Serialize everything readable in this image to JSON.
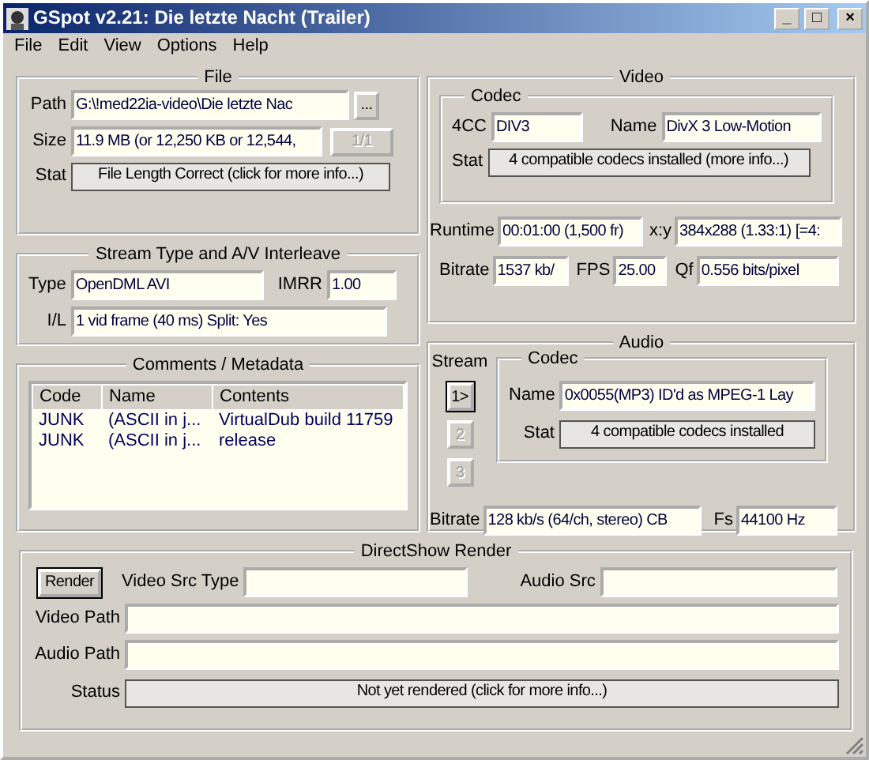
{
  "window": {
    "title": "GSpot v2.21: Die letzte Nacht (Trailer)",
    "controls": [
      "_",
      "□",
      "×"
    ]
  },
  "menu": [
    "File",
    "Edit",
    "View",
    "Options",
    "Help"
  ],
  "file": {
    "title": "File",
    "path": {
      "label": "Path",
      "value": "G:\\!med22ia-video\\Die letzte Nac"
    },
    "browse_button": "...",
    "size": {
      "label": "Size",
      "value": "11.9 MB (or 12,250 KB or 12,544,"
    },
    "counter_button": {
      "label": "1/1",
      "disabled": true
    },
    "stat": {
      "label": "Stat",
      "value": "File Length Correct (click for more info...)"
    }
  },
  "stream_type": {
    "title": "Stream Type and A/V Interleave",
    "type": {
      "label": "Type",
      "value": "OpenDML AVI"
    },
    "imrr": {
      "label": "IMRR",
      "value": "1.00"
    },
    "interleave": {
      "label": "I/L",
      "value": "1 vid frame (40 ms)  Split: Yes"
    }
  },
  "comments": {
    "title": "Comments / Metadata",
    "columns": [
      "Code",
      "Name",
      "Contents"
    ],
    "rows": [
      [
        "JUNK",
        "(ASCII in j...",
        "VirtualDub build 11759"
      ],
      [
        "JUNK",
        "(ASCII in j...",
        "release"
      ]
    ]
  },
  "video": {
    "title": "Video",
    "codec": {
      "title": "Codec",
      "fourcc": {
        "label": "4CC",
        "value": "DIV3"
      },
      "name": {
        "label": "Name",
        "value": "DivX 3 Low-Motion"
      },
      "stat": {
        "label": "Stat",
        "value": "4 compatible codecs installed (more info...)"
      }
    },
    "runtime": {
      "label": "Runtime",
      "value": "00:01:00 (1,500 fr)"
    },
    "xy": {
      "label": "x:y",
      "value": "384x288 (1.33:1) [=4:"
    },
    "bitrate": {
      "label": "Bitrate",
      "value": "1537 kb/"
    },
    "fps": {
      "label": "FPS",
      "value": "25.00"
    },
    "qf": {
      "label": "Qf",
      "value": "0.556 bits/pixel"
    }
  },
  "audio": {
    "title": "Audio",
    "stream_label": "Stream",
    "streams": [
      {
        "label": "1>",
        "disabled": false
      },
      {
        "label": "2",
        "disabled": true
      },
      {
        "label": "3",
        "disabled": true
      }
    ],
    "codec": {
      "title": "Codec",
      "name": {
        "label": "Name",
        "value": "0x0055(MP3) ID'd as MPEG-1 Lay"
      },
      "stat": {
        "label": "Stat",
        "value": "4 compatible codecs installed"
      }
    },
    "bitrate": {
      "label": "Bitrate",
      "value": "128 kb/s (64/ch, stereo) CB"
    },
    "fs": {
      "label": "Fs",
      "value": "44100 Hz"
    }
  },
  "directshow": {
    "title": "DirectShow Render",
    "render_button": "Render",
    "video_src_type": {
      "label": "Video Src Type"
    },
    "audio_src": {
      "label": "Audio Src"
    },
    "video_path": {
      "label": "Video Path"
    },
    "audio_path": {
      "label": "Audio Path"
    },
    "status": {
      "label": "Status",
      "value": "Not yet rendered (click for more info...)"
    }
  }
}
